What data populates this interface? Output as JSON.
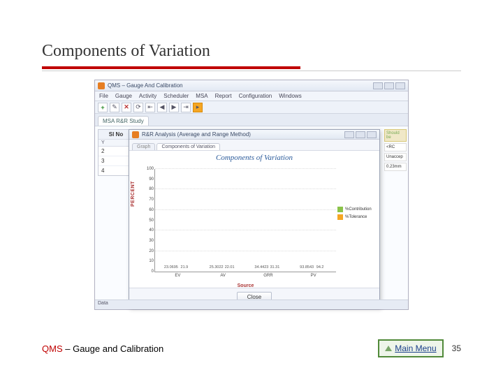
{
  "slide": {
    "title": "Components of Variation",
    "footer_app": "QMS",
    "footer_rest": " – Gauge and Calibration",
    "main_menu": "Main Menu",
    "page_num": "35"
  },
  "app": {
    "window_title": "QMS – Gauge And Calibration",
    "menu": {
      "file": "File",
      "gauge": "Gauge",
      "activity": "Activity",
      "scheduler": "Scheduler",
      "msa": "MSA",
      "report": "Report",
      "configuration": "Configuration",
      "windows": "Windows"
    },
    "tab_main": "MSA R&R Study",
    "left": {
      "header": "Sl No",
      "col": "Y",
      "r1": "2",
      "r2": "3",
      "r3": "4"
    },
    "right": {
      "h1": "Should be",
      "i1": "<RC",
      "i2": "Unaccep",
      "i3": "0.23mm"
    },
    "status": "Data"
  },
  "dialog": {
    "title": "R&R Analysis (Average and Range Method)",
    "tab1": "Graph",
    "tab2": "Components of Variation",
    "chart_title": "Components of Variation",
    "ylabel": "PERCENT",
    "xlabel": "Source",
    "legend1": "%Contribution",
    "legend2": "%Tolerance",
    "close": "Close",
    "ticks": {
      "t0": "0",
      "t10": "10",
      "t20": "20",
      "t30": "30",
      "t40": "40",
      "t50": "50",
      "t60": "60",
      "t70": "70",
      "t80": "80",
      "t90": "90",
      "t100": "100"
    },
    "cats": {
      "c0": "EV",
      "c1": "AV",
      "c2": "GRR",
      "c3": "PV"
    },
    "vals": {
      "ev_g": "23.0695",
      "ev_o": "21.9",
      "av_g": "25.3022",
      "av_o": "22.01",
      "grr_g": "34.4423",
      "grr_o": "31.31",
      "pv_g": "93.8543",
      "pv_o": "94.2"
    }
  },
  "chart_data": {
    "type": "bar",
    "title": "Components of Variation",
    "xlabel": "Source",
    "ylabel": "PERCENT",
    "ylim": [
      0,
      100
    ],
    "categories": [
      "EV",
      "AV",
      "GRR",
      "PV"
    ],
    "series": [
      {
        "name": "%Contribution",
        "values": [
          23.0695,
          25.3022,
          34.4423,
          93.8543
        ]
      },
      {
        "name": "%Tolerance",
        "values": [
          21.9,
          22.01,
          31.31,
          94.2
        ]
      }
    ]
  }
}
